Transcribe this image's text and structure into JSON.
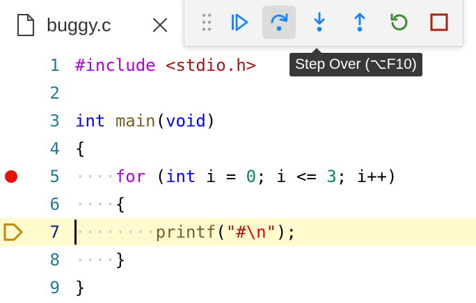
{
  "tab": {
    "title": "buggy.c",
    "file_icon": "file-icon",
    "close_icon": "close-icon"
  },
  "debug_toolbar": {
    "buttons": [
      {
        "name": "continue",
        "icon": "continue-icon",
        "color": "#1a85ff"
      },
      {
        "name": "step-over",
        "icon": "step-over-icon",
        "color": "#1a85ff",
        "active": true
      },
      {
        "name": "step-into",
        "icon": "step-into-icon",
        "color": "#1a85ff"
      },
      {
        "name": "step-out",
        "icon": "step-out-icon",
        "color": "#1a85ff"
      },
      {
        "name": "restart",
        "icon": "restart-icon",
        "color": "#388a34"
      },
      {
        "name": "stop",
        "icon": "stop-icon",
        "color": "#a1260d"
      }
    ],
    "tooltip": "Step Over (⌥F10)"
  },
  "editor": {
    "current_line": 7,
    "breakpoint_line": 5,
    "lines": [
      {
        "number": "1"
      },
      {
        "number": "2"
      },
      {
        "number": "3"
      },
      {
        "number": "4"
      },
      {
        "number": "5"
      },
      {
        "number": "6"
      },
      {
        "number": "7"
      },
      {
        "number": "8"
      },
      {
        "number": "9"
      }
    ],
    "tokens": {
      "l1_include": "#include",
      "l1_header": "<stdio.h>",
      "l3_int": "int",
      "l3_main": "main",
      "l3_open": "(",
      "l3_void": "void",
      "l3_close": ")",
      "l4_brace": "{",
      "l5_ws": "····",
      "l5_for": "for",
      "l5_open": " (",
      "l5_int": "int",
      "l5_i_eq": " i = ",
      "l5_zero": "0",
      "l5_cond": "; i <= ",
      "l5_three": "3",
      "l5_inc": "; i++)",
      "l6_ws": "····",
      "l6_brace": "{",
      "l7_ws": "········",
      "l7_printf": "printf",
      "l7_open": "(",
      "l7_str_a": "\"#",
      "l7_esc": "\\n",
      "l7_str_b": "\"",
      "l7_close": ");",
      "l8_ws": "····",
      "l8_brace": "}",
      "l9_brace": "}"
    }
  }
}
